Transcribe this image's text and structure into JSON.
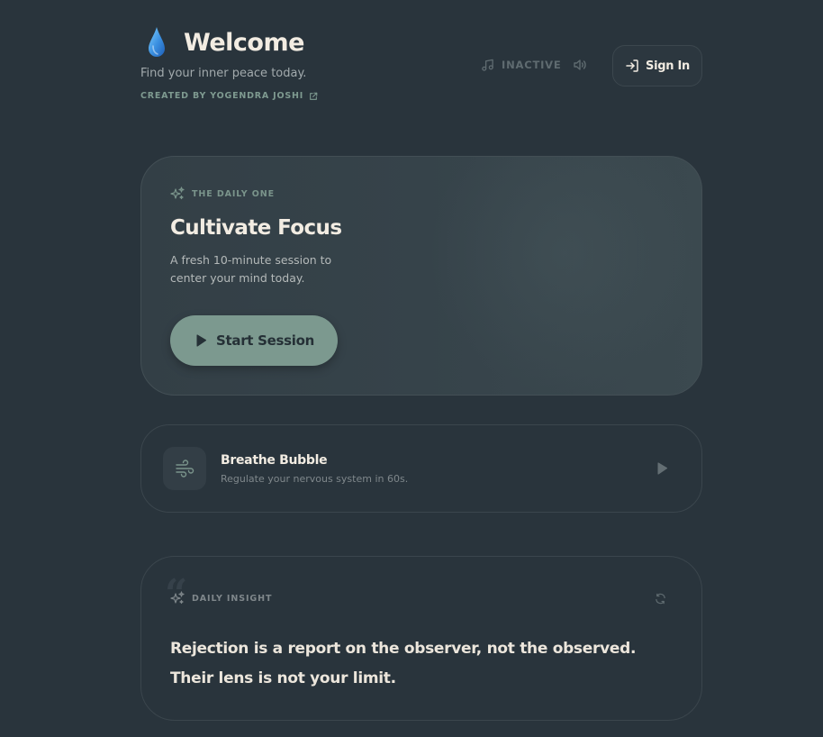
{
  "header": {
    "title": "Welcome",
    "subtitle": "Find your inner peace today.",
    "creator": "CREATED BY YOGENDRA JOSHI",
    "audio_status": "INACTIVE",
    "sign_in_label": "Sign In"
  },
  "hero": {
    "eyebrow": "THE DAILY ONE",
    "title": "Cultivate Focus",
    "description": "A fresh 10-minute session to center your mind today.",
    "cta_label": "Start Session"
  },
  "breathe": {
    "title": "Breathe Bubble",
    "description": "Regulate your nervous system in 60s."
  },
  "insight": {
    "eyebrow": "DAILY INSIGHT",
    "quote_mark": "“",
    "quote": "Rejection is a report on the observer, not the observed. Their lens is not your limit."
  },
  "icons": {
    "brand": "water-drop-icon",
    "creator": "external-link-icon",
    "audio": "music-note-icon",
    "volume": "speaker-icon",
    "sign_in": "sign-in-icon",
    "hero_eyebrow": "sparkles-icon",
    "cta": "play-icon",
    "breathe": "wind-icon",
    "breathe_action": "play-icon",
    "insight_eyebrow": "sparkles-icon",
    "insight_action": "refresh-icon"
  },
  "colors": {
    "background": "#29343c",
    "accent": "#7c998f",
    "text": "#f2ece2",
    "drop": "#3a8fe0"
  }
}
